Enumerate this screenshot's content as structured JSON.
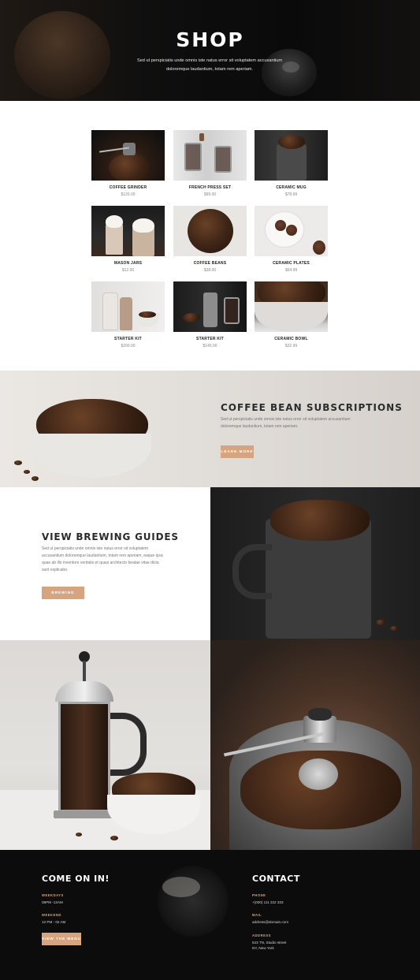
{
  "hero": {
    "title": "SHOP",
    "text": "Sed ut perspiciatis unde omnis iste natus error sit voluptatem accusantium doloremque laudantium, totam rem aperiam."
  },
  "products": [
    {
      "name": "COFFEE GRINDER",
      "price": "$120.00"
    },
    {
      "name": "FRENCH PRESS SET",
      "price": "$99.00"
    },
    {
      "name": "CERAMIC MUG",
      "price": "$78.99"
    },
    {
      "name": "MASON JARS",
      "price": "$12.00"
    },
    {
      "name": "COFFEE BEANS",
      "price": "$38.00"
    },
    {
      "name": "CERAMIC PLATES",
      "price": "$64.99"
    },
    {
      "name": "STARTER KIT",
      "price": "$200.00"
    },
    {
      "name": "STARTER KIT",
      "price": "$145.00"
    },
    {
      "name": "CERAMIC BOWL",
      "price": "$32.99"
    }
  ],
  "subscriptions": {
    "title": "COFFEE BEAN SUBSCRIPTIONS",
    "text": "Sed ut perspiciatis unde omnis iste natus error sit voluptatem accusantium doloremque laudantium, totam rem aperiam.",
    "button": "LEARN MORE"
  },
  "brewing": {
    "title": "VIEW BREWING GUIDES",
    "text": "Sed ut perspiciatis unde omnis iste natus error sit voluptatem accusantium doloremque laudantium, totam rem aperiam, eaque ipsa quae ab illo inventore veritatis et quasi architecto beatae vitae dicta sunt explicabo.",
    "button": "BREWING GUIDES"
  },
  "footer": {
    "come_title": "COME ON IN!",
    "weekdays_label": "WEEKDAYS",
    "weekdays_value": "08PM -12AM",
    "weekend_label": "WEEKEND",
    "weekend_value": "12 PM - 02 AM",
    "menu_button": "VIEW THE MENU",
    "contact_title": "CONTACT",
    "phone_label": "PHONE",
    "phone_value": "+(000) 111 222 333",
    "mail_label": "MAIL",
    "mail_value": "address@domain.com",
    "address_label": "ADDRESS",
    "address_line1": "543 TN, Studio street",
    "address_line2": "NY, New York"
  },
  "colors": {
    "accent": "#d6a47e",
    "dark": "#0c0c0c"
  }
}
